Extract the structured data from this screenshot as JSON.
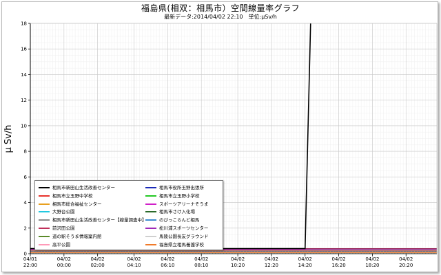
{
  "title": "福島県(相双：相馬市）空間線量率グラフ",
  "subtitle": "最新データ:2014/04/02 22:10　単位:μSv/h",
  "chart_data": {
    "type": "line",
    "ylabel": "μ Sv/h",
    "xlabel": "",
    "ylim": [
      0,
      18
    ],
    "yticks": [
      "0",
      "2",
      "4",
      "6",
      "8",
      "10",
      "12",
      "14",
      "16",
      "18"
    ],
    "x_start": "04/01 22:00",
    "x_end": "04/02 22:10",
    "xticks": [
      {
        "date": "04/01",
        "time": "22:00"
      },
      {
        "date": "04/02",
        "time": "00:00"
      },
      {
        "date": "04/02",
        "time": "02:00"
      },
      {
        "date": "04/02",
        "time": "04:10"
      },
      {
        "date": "04/02",
        "time": "06:10"
      },
      {
        "date": "04/02",
        "time": "08:10"
      },
      {
        "date": "04/02",
        "time": "10:20"
      },
      {
        "date": "04/02",
        "time": "12:20"
      },
      {
        "date": "04/02",
        "time": "14:20"
      },
      {
        "date": "04/02",
        "time": "16:20"
      },
      {
        "date": "04/02",
        "time": "18:20"
      },
      {
        "date": "04/02",
        "time": "20:20"
      }
    ],
    "grid": true,
    "legend_position": "bottom-left",
    "spike": {
      "series": "相馬市新田山生活改善センター",
      "start_time": "04/02 14:20",
      "y_from": 0.4,
      "y_to": 18,
      "y_at_end": 18
    },
    "series": [
      {
        "name": "相馬市新田山生活改善センター",
        "color": "#000000",
        "level": 0.4
      },
      {
        "name": "相馬市立玉野中学校",
        "color": "#e8312a",
        "level": 0.39
      },
      {
        "name": "相馬市総合福祉センター",
        "color": "#e8a020",
        "level": 0.3
      },
      {
        "name": "大野台公園",
        "color": "#22c8e0",
        "level": 0.28
      },
      {
        "name": "相馬市新田山生活改善センター【線量調査中】",
        "color": "#8a8a8a",
        "level": 0.26
      },
      {
        "name": "前沢田公園",
        "color": "#c0305a",
        "level": 0.24
      },
      {
        "name": "道の駅そうま情報案内館",
        "color": "#5a8a2a",
        "level": 0.22
      },
      {
        "name": "高平公園",
        "color": "#ff9ab8",
        "level": 0.2
      },
      {
        "name": "相馬市役所玉野出張所",
        "color": "#1a2ab8",
        "level": 0.36
      },
      {
        "name": "相馬市立玉野小学校",
        "color": "#22c822",
        "level": 0.34
      },
      {
        "name": "スポーツアリーナそうま",
        "color": "#d020c8",
        "level": 0.32
      },
      {
        "name": "相馬市さけ入化場",
        "color": "#2a6a2a",
        "level": 0.18
      },
      {
        "name": "のびっこらんど相馬",
        "color": "#3a8ad0",
        "level": 0.16
      },
      {
        "name": "松川浦スポーツセンター",
        "color": "#a02ab8",
        "level": 0.14
      },
      {
        "name": "馬陵公園長友グラウンド",
        "color": "#cfcfcf",
        "level": 0.12
      },
      {
        "name": "福島県立相馬養護学校",
        "color": "#f07a2a",
        "level": 0.1
      }
    ]
  }
}
